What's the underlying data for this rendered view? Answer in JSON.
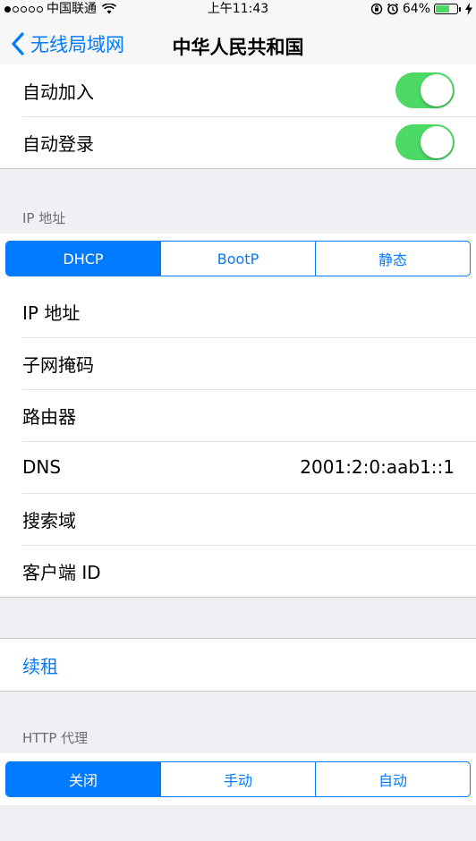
{
  "status": {
    "carrier": "中国联通",
    "time": "上午11:43",
    "battery_pct": "64%",
    "battery_level": 0.64
  },
  "nav": {
    "back_label": "无线局域网",
    "title": "中华人民共和国"
  },
  "top_rows": [
    {
      "label": "自动加入",
      "on": true
    },
    {
      "label": "自动登录",
      "on": true
    }
  ],
  "ip_section": {
    "header": "IP 地址",
    "segments": [
      "DHCP",
      "BootP",
      "静态"
    ],
    "selected": 0,
    "rows": [
      {
        "label": "IP 地址",
        "value": ""
      },
      {
        "label": "子网掩码",
        "value": ""
      },
      {
        "label": "路由器",
        "value": ""
      },
      {
        "label": "DNS",
        "value": "2001:2:0:aab1::1"
      },
      {
        "label": "搜索域",
        "value": ""
      },
      {
        "label": "客户端 ID",
        "value": ""
      }
    ]
  },
  "renew": {
    "label": "续租"
  },
  "proxy_section": {
    "header": "HTTP 代理",
    "segments": [
      "关闭",
      "手动",
      "自动"
    ],
    "selected": 0
  },
  "colors": {
    "accent": "#007aff",
    "toggle_on": "#4cd964",
    "background": "#efeff4"
  }
}
